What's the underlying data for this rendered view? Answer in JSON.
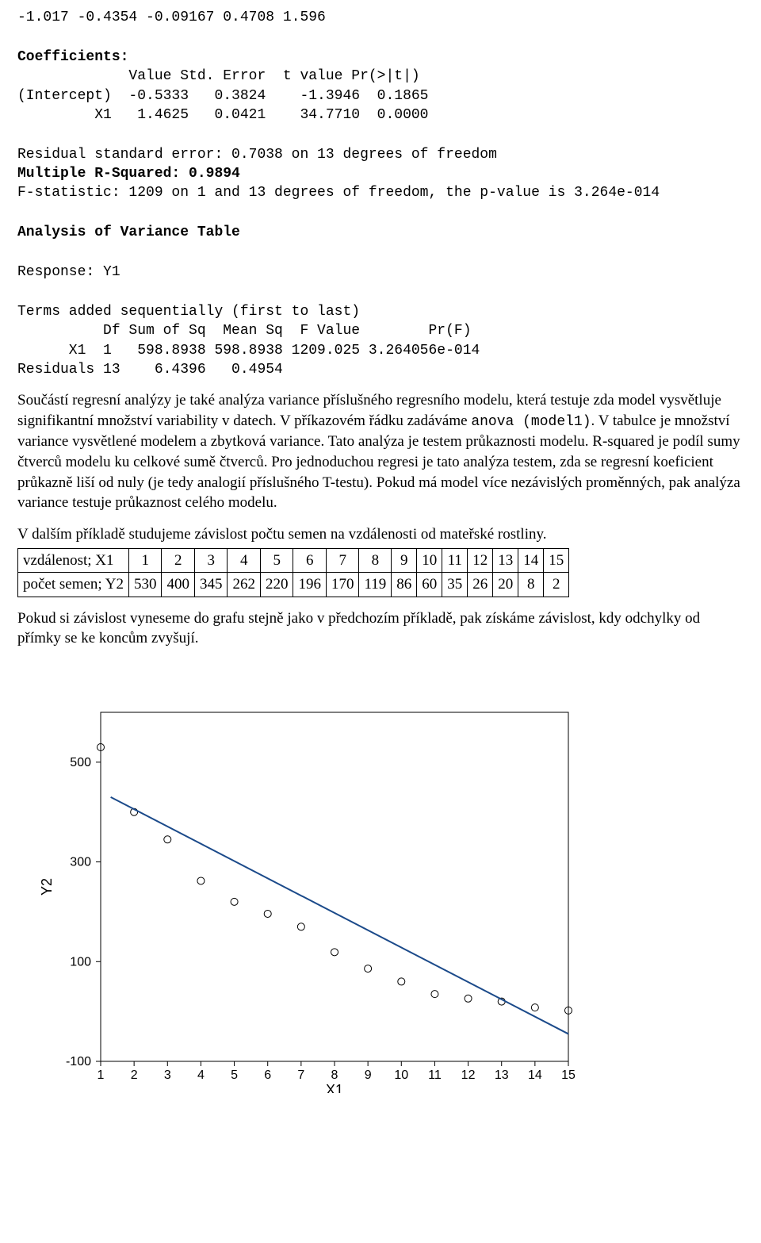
{
  "quantiles_line": "-1.017 -0.4354 -0.09167 0.4708 1.596",
  "coef_header": "Coefficients:",
  "coef_cols": "             Value Std. Error  t value Pr(>|t|)",
  "coef_row1": "(Intercept)  -0.5333   0.3824    -1.3946  0.1865",
  "coef_row2": "         X1   1.4625   0.0421    34.7710  0.0000",
  "rse_line": "Residual standard error: 0.7038 on 13 degrees of freedom",
  "rsq_line": "Multiple R-Squared: 0.9894",
  "fstat_line": "F-statistic: 1209 on 1 and 13 degrees of freedom, the p-value is 3.264e-014",
  "anova_header": "Analysis of Variance Table",
  "anova_resp": "Response: Y1",
  "anova_terms": "Terms added sequentially (first to last)",
  "anova_cols": "          Df Sum of Sq  Mean Sq  F Value        Pr(F)",
  "anova_row1": "      X1  1   598.8938 598.8938 1209.025 3.264056e-014",
  "anova_row2": "Residuals 13    6.4396   0.4954",
  "para1_a": "Součástí regresní analýzy je také analýza variance příslušného regresního modelu, která testuje zda model vysvětluje signifikantní množství variability v datech. V příkazovém řádku zadáváme ",
  "para1_code": "anova (model1)",
  "para1_b": ". V tabulce je množství variance vysvětlené modelem a zbytková variance. Tato analýza je testem průkaznosti modelu. R-squared je podíl sumy čtverců modelu ku celkové sumě čtverců. Pro jednoduchou regresi je tato analýza testem, zda se regresní koeficient průkazně liší od nuly (je tedy analogií příslušného T-testu). Pokud má model více nezávislých proměnných, pak analýza variance testuje průkaznost celého modelu.",
  "para2": "V dalším příkladě studujeme závislost počtu semen na vzdálenosti od mateřské rostliny.",
  "table": {
    "row1_label": "vzdálenost; X1",
    "row1": [
      "1",
      "2",
      "3",
      "4",
      "5",
      "6",
      "7",
      "8",
      "9",
      "10",
      "11",
      "12",
      "13",
      "14",
      "15"
    ],
    "row2_label": "počet semen; Y2",
    "row2": [
      "530",
      "400",
      "345",
      "262",
      "220",
      "196",
      "170",
      "119",
      "86",
      "60",
      "35",
      "26",
      "20",
      "8",
      "2"
    ]
  },
  "para3": "Pokud si závislost vyneseme do grafu stejně jako v předchozím příkladě, pak získáme závislost, kdy odchylky od přímky se ke koncům zvyšují.",
  "chart_data": {
    "type": "scatter",
    "xlabel": "X1",
    "ylabel": "Y2",
    "xlim": [
      1,
      15
    ],
    "ylim": [
      -100,
      600
    ],
    "x_ticks": [
      1,
      2,
      3,
      4,
      5,
      6,
      7,
      8,
      9,
      10,
      11,
      12,
      13,
      14,
      15
    ],
    "y_ticks": [
      -100,
      100,
      300,
      500
    ],
    "series": [
      {
        "name": "points",
        "x": [
          1,
          2,
          3,
          4,
          5,
          6,
          7,
          8,
          9,
          10,
          11,
          12,
          13,
          14,
          15
        ],
        "y": [
          530,
          400,
          345,
          262,
          220,
          196,
          170,
          119,
          86,
          60,
          35,
          26,
          20,
          8,
          2
        ]
      }
    ],
    "trend": {
      "x": [
        1.3,
        15
      ],
      "y": [
        430,
        -45
      ]
    }
  }
}
